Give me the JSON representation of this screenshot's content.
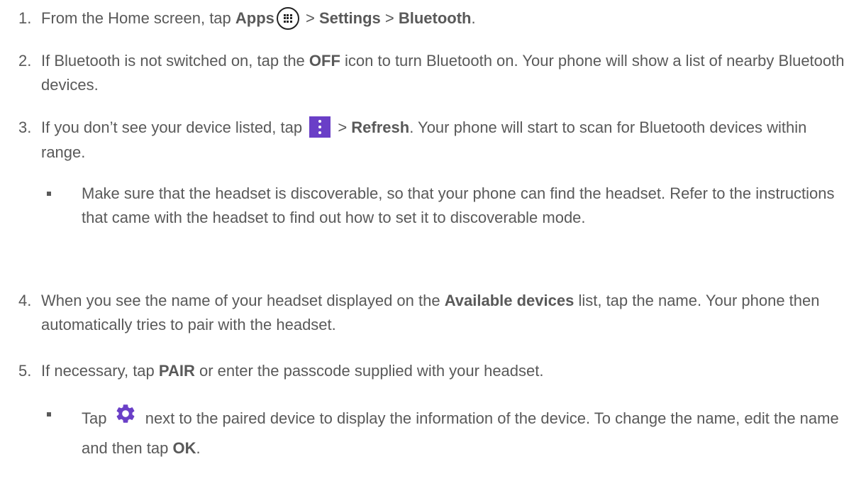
{
  "steps": [
    {
      "num": "1.",
      "parts": [
        "From the Home screen, tap ",
        "Apps",
        " > ",
        "Settings",
        " > ",
        "Bluetooth",
        "."
      ]
    },
    {
      "num": "2.",
      "parts": [
        "If Bluetooth is not switched on, tap the ",
        "OFF",
        " icon to turn Bluetooth on. Your phone will show a list of nearby Bluetooth devices."
      ]
    },
    {
      "num": "3.",
      "parts": [
        "If you don’t see your device listed, tap ",
        " > ",
        "Refresh",
        ". Your phone will start to scan for Bluetooth devices within range."
      ],
      "sub": "Make sure that the headset is discoverable, so that your phone can find the headset. Refer to the instructions that came with the headset to find out how to set it to discoverable mode."
    },
    {
      "num": "4.",
      "parts": [
        "When you see the name of your headset displayed on the ",
        "Available devices",
        " list, tap the name. Your phone then automatically tries to pair with the headset."
      ]
    },
    {
      "num": "5.",
      "parts": [
        "If necessary, tap ",
        "PAIR",
        " or enter the passcode supplied with your headset."
      ],
      "sub_parts": [
        "Tap ",
        " next to the paired device to display the information of the device. To change the name, edit the name and then tap ",
        "OK",
        "."
      ]
    }
  ],
  "icons": {
    "apps": "apps-icon",
    "menu": "more-options-icon",
    "gear": "gear-icon",
    "menu_color": "#6a3fc7"
  }
}
